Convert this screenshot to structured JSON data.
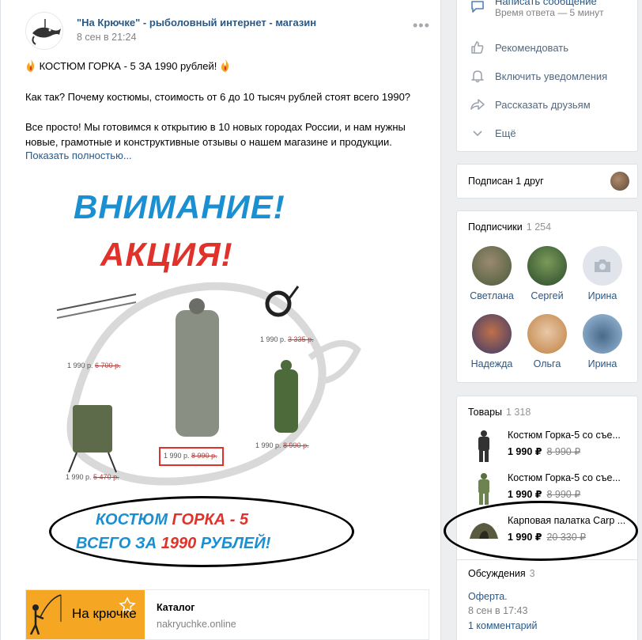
{
  "post": {
    "author": "\"На Крючке\" - рыболовный интернет - магазин",
    "date": "8 сен в 21:24",
    "menu_glyph": "•••",
    "title_line": "КОСТЮМ ГОРКА - 5 ЗА 1990 рублей!",
    "question": "Как так? Почему костюмы, стоимость от 6 до 10 тысяч рублей стоят всего 1990?",
    "para_line1": "Все просто! Мы готовимся к открытию в 10 новых городах России, и нам нужны",
    "para_line2": "новые, грамотные и конструктивные отзывы о нашем магазине и продукции.",
    "show_more": "Показать полностью...",
    "promo": {
      "title1": "ВНИМАНИЕ!",
      "title2": "АКЦИЯ!",
      "prices": [
        {
          "price": "1 990 р.",
          "old": "6 700 р."
        },
        {
          "price": "1 990 р.",
          "old": "3 335 р."
        },
        {
          "price": "1 990 р.",
          "old": "8 990 р."
        },
        {
          "price": "1 990 р.",
          "old": "8 990 р."
        },
        {
          "price": "1 990 р.",
          "old": "5 470 р."
        }
      ],
      "slogan_a": "КОСТЮМ ",
      "slogan_b": "ГОРКА - 5",
      "slogan_c": "ВСЕГО ЗА ",
      "slogan_d": "1990",
      "slogan_e": " РУБЛЕЙ!"
    },
    "link": {
      "logo_text": "На крючке",
      "title": "Каталог",
      "url": "nakryuchke.online"
    }
  },
  "actions": {
    "message": "Написать сообщение",
    "reply_time": "Время ответа — 5 минут",
    "recommend": "Рекомендовать",
    "notify": "Включить уведомления",
    "share": "Рассказать друзьям",
    "more": "Ещё"
  },
  "friends": {
    "label": "Подписан 1 друг"
  },
  "subscribers": {
    "label": "Подписчики",
    "count": "1 254",
    "people": [
      "Светлана",
      "Сергей",
      "Ирина",
      "Надежда",
      "Ольга",
      "Ирина"
    ]
  },
  "goods": {
    "label": "Товары",
    "count": "1 318",
    "items": [
      {
        "title": "Костюм Горка-5 со съе...",
        "price": "1 990 ₽",
        "old": "8 990 ₽"
      },
      {
        "title": "Костюм Горка-5 со съе...",
        "price": "1 990 ₽",
        "old": "8 990 ₽"
      },
      {
        "title": "Карповая палатка Carp ...",
        "price": "1 990 ₽",
        "old": "20 330 ₽"
      }
    ]
  },
  "discussions": {
    "label": "Обсуждения",
    "count": "3",
    "topic": "Оферта.",
    "date": "8 сен в 17:43",
    "comments": "1 комментарий"
  },
  "colors": {
    "link": "#2a5885",
    "accent_blue": "#1a8fd1",
    "accent_red": "#e0322a"
  }
}
